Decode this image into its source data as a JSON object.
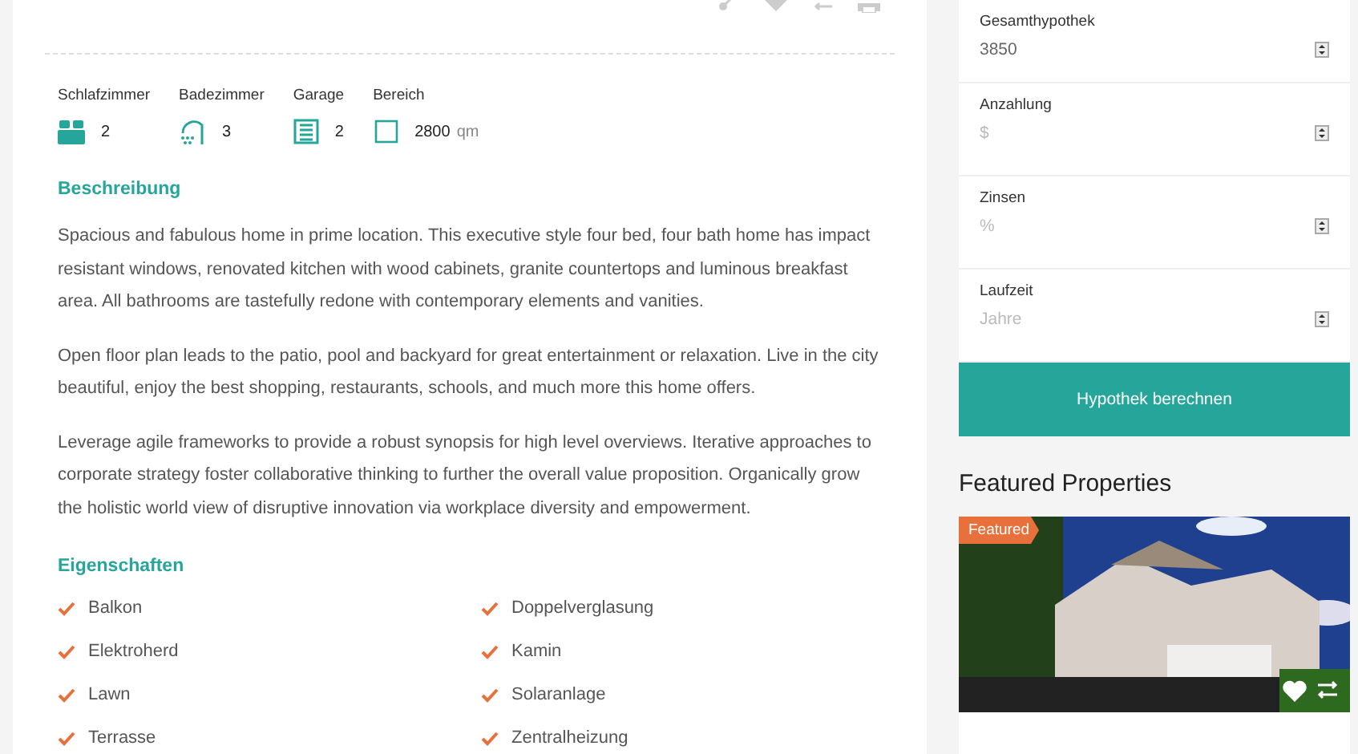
{
  "specs": [
    {
      "kind": "bed",
      "label": "Schlafzimmer",
      "value": "2"
    },
    {
      "kind": "shower",
      "label": "Badezimmer",
      "value": "3"
    },
    {
      "kind": "garage",
      "label": "Garage",
      "value": "2"
    },
    {
      "kind": "area",
      "label": "Bereich",
      "value": "2800",
      "unit": "qm"
    }
  ],
  "description": {
    "title": "Beschreibung",
    "paragraphs": [
      "Spacious and fabulous home in prime location. This executive style four bed, four bath home has impact resistant windows, renovated kitchen with wood cabinets, granite countertops and luminous breakfast area. All bathrooms are tastefully redone with contemporary elements and vanities.",
      "Open floor plan leads to the patio, pool and backyard for great entertainment or relaxation. Live in the city beautiful, enjoy the best shopping, restaurants, schools, and much more this home offers.",
      "Leverage agile frameworks to provide a robust synopsis for high level overviews. Iterative approaches to corporate strategy foster collaborative thinking to further the overall value proposition. Organically grow the holistic world view of disruptive innovation via workplace diversity and empowerment."
    ]
  },
  "features": {
    "title": "Eigenschaften",
    "items": [
      "Balkon",
      "Doppelverglasung",
      "Elektroherd",
      "Kamin",
      "Lawn",
      "Solaranlage",
      "Terrasse",
      "Zentralheizung"
    ]
  },
  "calculator": {
    "fields": [
      {
        "label": "Gesamthypothek",
        "value": "3850"
      },
      {
        "label": "Anzahlung",
        "placeholder": "$"
      },
      {
        "label": "Zinsen",
        "placeholder": "%"
      },
      {
        "label": "Laufzeit",
        "placeholder": "Jahre"
      }
    ],
    "button": "Hypothek berechnen"
  },
  "featured": {
    "title": "Featured Properties",
    "badge": "Featured"
  }
}
